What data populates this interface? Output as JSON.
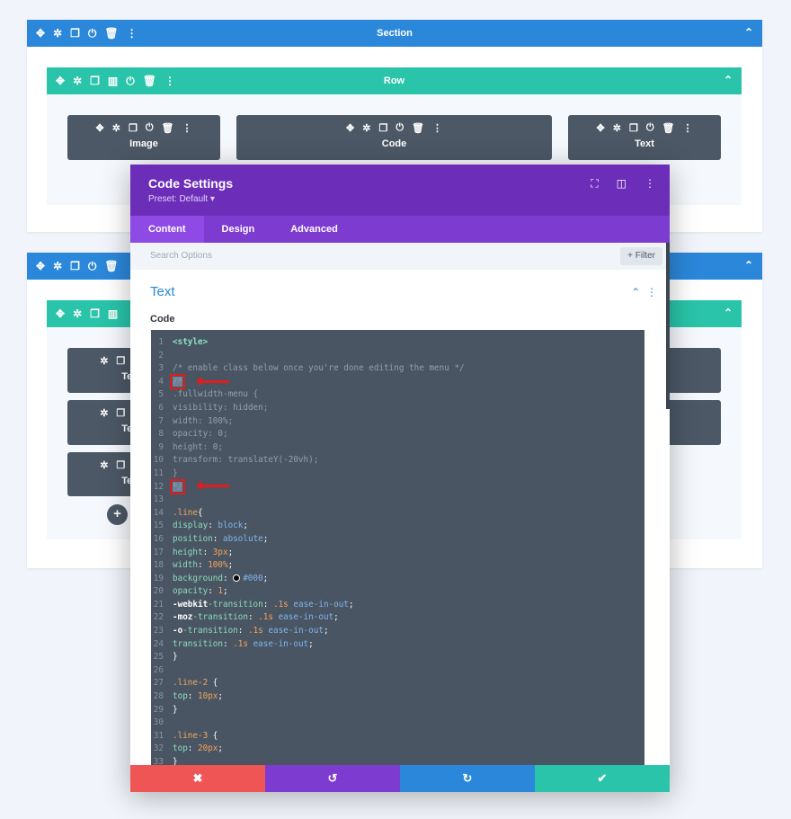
{
  "colors": {
    "section": "#2b87da",
    "row": "#29c4a9",
    "module": "#4c5866",
    "modal_header": "#6c2eb9",
    "tabs": "#7d3bd0",
    "cancel": "#ef5555",
    "undo": "#7d3bcf",
    "redo": "#2b87da",
    "save": "#29c4a9"
  },
  "section1": {
    "label": "Section",
    "icons": [
      "move-icon",
      "gear-icon",
      "duplicate-icon",
      "power-icon",
      "trash-icon",
      "more-icon"
    ]
  },
  "row1": {
    "label": "Row"
  },
  "modules_row1": [
    {
      "label": "Image"
    },
    {
      "label": "Code"
    },
    {
      "label": "Text"
    }
  ],
  "modules_row2": [
    {
      "label": "Text"
    },
    {
      "label": "Text"
    },
    {
      "label": "Text"
    }
  ],
  "modal": {
    "title": "Code Settings",
    "preset": "Preset: Default ▾",
    "tabs": [
      {
        "label": "Content",
        "active": true
      },
      {
        "label": "Design"
      },
      {
        "label": "Advanced"
      }
    ],
    "search_placeholder": "Search Options",
    "filter_label": "+ Filter",
    "group_title": "Text",
    "field_label": "Code",
    "code_lines": [
      [
        [
          "<style>",
          "tag"
        ]
      ],
      [],
      [
        [
          "/* enable class below once you're done editing the menu */",
          "com"
        ]
      ],
      [
        [
          "/*",
          "com",
          "hl"
        ]
      ],
      [
        [
          ".fullwidth-menu {",
          "com"
        ]
      ],
      [
        [
          "visibility: hidden;",
          "com"
        ]
      ],
      [
        [
          "width: 100%;",
          "com"
        ]
      ],
      [
        [
          "opacity: 0;",
          "com"
        ]
      ],
      [
        [
          "height: 0;",
          "com"
        ]
      ],
      [
        [
          "transform: translateY(-20vh);",
          "com"
        ]
      ],
      [
        [
          "}",
          "com"
        ]
      ],
      [
        [
          "*/",
          "com",
          "hl"
        ]
      ],
      [],
      [
        [
          ".line",
          "sel"
        ],
        [
          "{",
          "pun"
        ]
      ],
      [
        [
          "display",
          "prop"
        ],
        [
          ": ",
          "pun"
        ],
        [
          "block",
          "val"
        ],
        [
          ";",
          "pun"
        ]
      ],
      [
        [
          "position",
          "prop"
        ],
        [
          ": ",
          "pun"
        ],
        [
          "absolute",
          "val"
        ],
        [
          ";",
          "pun"
        ]
      ],
      [
        [
          "height",
          "prop"
        ],
        [
          ": ",
          "pun"
        ],
        [
          "3px",
          "num"
        ],
        [
          ";",
          "pun"
        ]
      ],
      [
        [
          "width",
          "prop"
        ],
        [
          ": ",
          "pun"
        ],
        [
          "100%",
          "num"
        ],
        [
          ";",
          "pun"
        ]
      ],
      [
        [
          "background",
          "prop"
        ],
        [
          ": ",
          "pun"
        ],
        [
          "",
          "dot"
        ],
        [
          "#000",
          "val"
        ],
        [
          ";",
          "pun"
        ]
      ],
      [
        [
          "opacity",
          "prop"
        ],
        [
          ": ",
          "pun"
        ],
        [
          "1",
          "num"
        ],
        [
          ";",
          "pun"
        ]
      ],
      [
        [
          "-webkit",
          "bold"
        ],
        [
          "-transition",
          "prop"
        ],
        [
          ": ",
          "pun"
        ],
        [
          ".1s",
          "num"
        ],
        [
          " ease-in-out",
          "val"
        ],
        [
          ";",
          "pun"
        ]
      ],
      [
        [
          "-moz",
          "bold"
        ],
        [
          "-transition",
          "prop"
        ],
        [
          ": ",
          "pun"
        ],
        [
          ".1s",
          "num"
        ],
        [
          " ease-in-out",
          "val"
        ],
        [
          ";",
          "pun"
        ]
      ],
      [
        [
          "-o",
          "bold"
        ],
        [
          "-transition",
          "prop"
        ],
        [
          ": ",
          "pun"
        ],
        [
          ".1s",
          "num"
        ],
        [
          " ease-in-out",
          "val"
        ],
        [
          ";",
          "pun"
        ]
      ],
      [
        [
          "transition",
          "prop"
        ],
        [
          ": ",
          "pun"
        ],
        [
          ".1s",
          "num"
        ],
        [
          " ease-in-out",
          "val"
        ],
        [
          ";",
          "pun"
        ]
      ],
      [
        [
          "}",
          "pun"
        ]
      ],
      [],
      [
        [
          ".line-2",
          "sel"
        ],
        [
          " {",
          "pun"
        ]
      ],
      [
        [
          "top",
          "prop"
        ],
        [
          ": ",
          "pun"
        ],
        [
          "10px",
          "num"
        ],
        [
          ";",
          "pun"
        ]
      ],
      [
        [
          "}",
          "pun"
        ]
      ],
      [],
      [
        [
          ".line-3",
          "sel"
        ],
        [
          " {",
          "pun"
        ]
      ],
      [
        [
          "top",
          "prop"
        ],
        [
          ": ",
          "pun"
        ],
        [
          "20px",
          "num"
        ],
        [
          ";",
          "pun"
        ]
      ],
      [
        [
          "}",
          "pun"
        ]
      ]
    ],
    "footer": [
      {
        "icon": "close-icon",
        "glyph": "✖"
      },
      {
        "icon": "undo-icon",
        "glyph": "↺"
      },
      {
        "icon": "redo-icon",
        "glyph": "↻"
      },
      {
        "icon": "check-icon",
        "glyph": "✔"
      }
    ]
  }
}
